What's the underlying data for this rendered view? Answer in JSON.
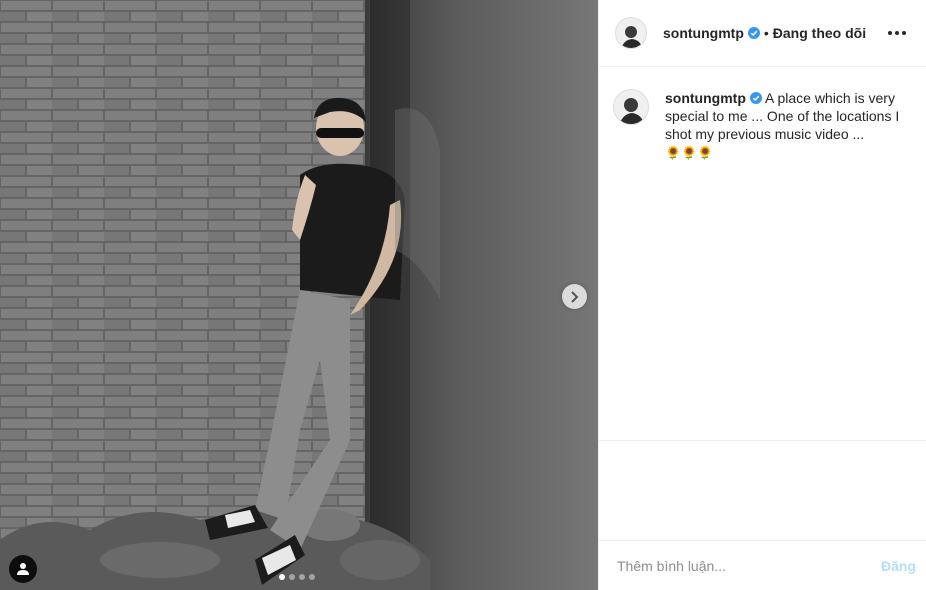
{
  "post": {
    "username": "sontungmtp",
    "separator": "•",
    "follow_status": "Đang theo dõi",
    "caption_line": "A place which is very special to me ... One of the locations I shot my previous music video ...",
    "caption_emojis": [
      "🌻",
      "🌻",
      "🌻"
    ]
  },
  "carousel": {
    "slides_total": 4,
    "active_index": 0
  },
  "icons": {
    "more": "more-horizontal-icon",
    "verified": "verified-badge-icon",
    "next": "chevron-right-icon",
    "user_tag": "user-tag-icon"
  },
  "comment": {
    "placeholder": "Thêm bình luận...",
    "post_label": "Đăng"
  },
  "colors": {
    "verified": "#3897f0",
    "post_button_disabled": "#b2dffc"
  }
}
